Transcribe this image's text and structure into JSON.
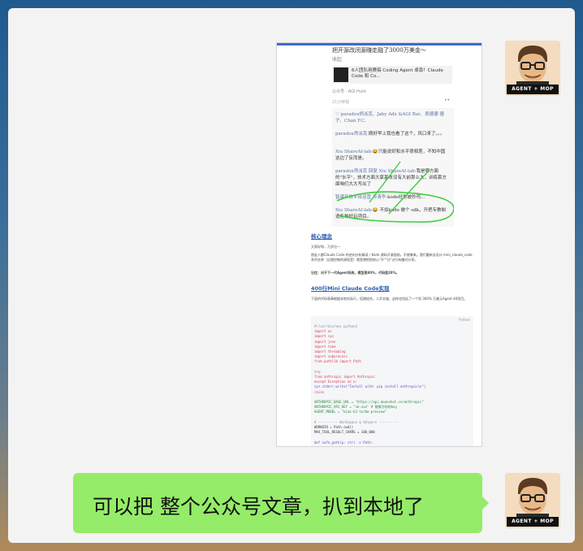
{
  "avatar": {
    "badge": "AGENT + MOP"
  },
  "shared_image": {
    "article_title": "把开源改闭源赚走融了3000万美金～",
    "collect": "收起",
    "card_title": "6人团队用赛搞 Coding Agent 卓靠！Claude Code 和 Co...",
    "source": "公众号 · AGI Hunt",
    "time": "21分钟前",
    "more": "••",
    "comments": [
      {
        "user": "♡ paradox师派克、Jaby Adx &AGI Bar、吴德德 德子、Chan F.C.",
        "text": ""
      },
      {
        "user": "paradox师派克:",
        "text": "刚好早上我也看了这个，风口来了。。。"
      },
      {
        "user": "Xiu ShareAI-lab:",
        "text": "😂只能说好和水平很相差，不知中国这边了反而是。"
      },
      {
        "user": "paradox师派克 回复 Xiu ShareAI-lab:",
        "text": "我是哪方面的\"水平\"，技术方面大家基本没有大前那么大，训练套方面咱们大大写出了"
      },
      {
        "user": "智谱开放平台运营 孙清华:",
        "text": "kode经常被抄吗..."
      },
      {
        "user": "Xiu ShareAI-lab:",
        "text": "😂 不如kode 做个 sdk，开把专教制造各种好玩项目。"
      }
    ],
    "heading1": "核心理念",
    "p1": "大家好呀，万岁位一",
    "p2": "朋友人都Claude Code 的逆向分析解读 / Kode 源码开源面前，不就拿来。我们重新去设计 mini_claude_code系列仓库（自我控制的源程室）就是想把把核心\"开\"\"分\"过行有趣对分享。",
    "p3": "记住：对于下一代Agent系统，模型是80%，代码是20%。",
    "heading2": "400行Mini Claude Code实现",
    "p4": "下面的代码表章根据本地实际行，搭建结合，二开实施，这样也包括了一个项 300% 万美元Agent 40项目。",
    "code_label": "Python",
    "code": [
      {
        "t": "#!/usr/bin/env python3",
        "c": "#7b8ba8"
      },
      {
        "t": "import os",
        "c": "#d73a49"
      },
      {
        "t": "import sys",
        "c": "#d73a49"
      },
      {
        "t": "import json",
        "c": "#d73a49"
      },
      {
        "t": "import time",
        "c": "#d73a49"
      },
      {
        "t": "import threading",
        "c": "#d73a49"
      },
      {
        "t": "import subprocess",
        "c": "#d73a49"
      },
      {
        "t": "from pathlib import Path",
        "c": "#d73a49"
      },
      {
        "t": "",
        "c": "#333"
      },
      {
        "t": "try:",
        "c": "#d73a49"
      },
      {
        "t": "    from anthropic import Anthropic",
        "c": "#d73a49"
      },
      {
        "t": "except Exception as e:",
        "c": "#d73a49"
      },
      {
        "t": "    sys.stderr.write(\"Install with: pip install anthropic\\n\")",
        "c": "#6f42c1"
      },
      {
        "t": "    raise",
        "c": "#d73a49"
      },
      {
        "t": "",
        "c": "#333"
      },
      {
        "t": "ANTHROPIC_BASE_URL = \"https://api.moonshot.cn/anthropic\"",
        "c": "#22863a"
      },
      {
        "t": "ANTHROPIC_API_KEY = \"sk-xxx\"  # 替换为你的key",
        "c": "#22863a"
      },
      {
        "t": "AGENT_MODEL = \"kimi-k2-turbo-preview\"",
        "c": "#22863a"
      },
      {
        "t": "",
        "c": "#333"
      },
      {
        "t": "# ---------- Workspace & Helpers ----------",
        "c": "#7b8ba8"
      },
      {
        "t": "WORKDIR = Path.cwd()",
        "c": "#333"
      },
      {
        "t": "MAX_TOOL_RESULT_CHARS = 100_000",
        "c": "#333"
      },
      {
        "t": "",
        "c": "#333"
      },
      {
        "t": "def safe_path(p: str) -> Path:",
        "c": "#6f42c1"
      }
    ]
  },
  "message": {
    "text": "可以把 整个公众号文章，扒到本地了"
  }
}
